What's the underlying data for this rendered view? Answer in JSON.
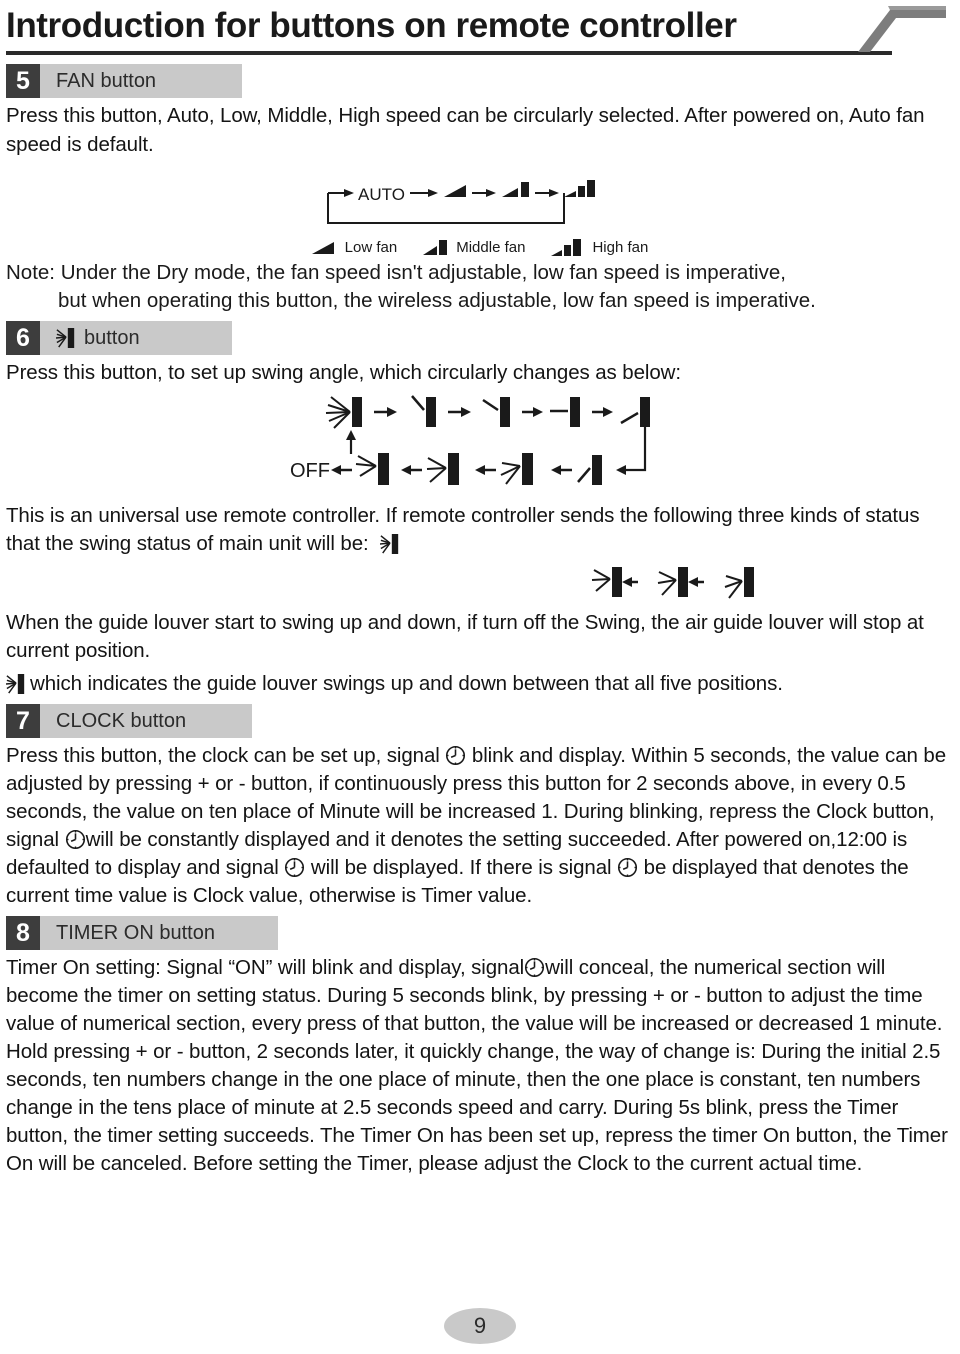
{
  "page": {
    "title": "Introduction for buttons on remote controller",
    "page_number": "9"
  },
  "sections": [
    {
      "number": "5",
      "label": "FAN button",
      "icon": null,
      "paragraphs": [
        "Press this button, Auto, Low, Middle, High speed can be circularly selected. After powered on, Auto fan speed is default."
      ],
      "fan_cycle": {
        "auto_label": "AUTO",
        "steps": [
          "AUTO",
          "low-fan-icon",
          "middle-fan-icon",
          "high-fan-icon"
        ],
        "legend": [
          {
            "icon": "low-fan-icon",
            "label": "Low fan"
          },
          {
            "icon": "middle-fan-icon",
            "label": "Middle fan"
          },
          {
            "icon": "high-fan-icon",
            "label": "High fan"
          }
        ]
      },
      "note": {
        "line1": "Note: Under the Dry mode, the fan speed isn't adjustable, low fan speed is imperative,",
        "line2": "but when operating this button, the wireless adjustable, low fan speed is imperative."
      }
    },
    {
      "number": "6",
      "label": "button",
      "icon": "swing-icon",
      "intro": "Press this button, to set up swing angle, which circularly changes as below:",
      "swing_cycle": {
        "off_label": "OFF",
        "top_row": [
          "swing-all-icon",
          "louver-pos-1-icon",
          "louver-pos-2-icon",
          "louver-pos-3-icon",
          "louver-pos-4-icon"
        ],
        "bottom_row": [
          "louver-pos-5-icon",
          "swing-lower-icon",
          "swing-middle-icon",
          "swing-upper-icon"
        ]
      },
      "paragraphs": [
        "This is an universal use remote controller. If remote controller sends the following three kinds of status that the swing status of main unit will be:",
        "When the guide louver start to swing up and down, if turn off the Swing, the air guide louver will stop at current position.",
        "which indicates the guide louver swings up and down between that all five positions."
      ],
      "status_icons": [
        "swing-status-1-icon",
        "swing-status-2-icon",
        "swing-status-3-icon"
      ]
    },
    {
      "number": "7",
      "label": "CLOCK button",
      "icon": null,
      "text_runs": [
        {
          "t": "Press this button, the clock can be set up, signal "
        },
        {
          "icon": "clock-icon"
        },
        {
          "t": " blink and display. Within 5 seconds, the value can be adjusted by pressing + or - button, if continuously press this button for 2 seconds above, in every 0.5 seconds, the value on ten place of Minute will be increased 1. During blinking, repress the Clock button, signal "
        },
        {
          "icon": "clock-icon"
        },
        {
          "t": "will be constantly displayed and it denotes the setting succeeded. After powered on,12:00 is defaulted to display and signal "
        },
        {
          "icon": "clock-icon"
        },
        {
          "t": " will be displayed. If there is signal "
        },
        {
          "icon": "clock-icon"
        },
        {
          "t": " be displayed that denotes the current time value is Clock value, otherwise is Timer value."
        }
      ]
    },
    {
      "number": "8",
      "label": "TIMER ON button",
      "icon": null,
      "text_runs": [
        {
          "t": "Timer On setting: Signal “ON” will blink and display, signal"
        },
        {
          "icon": "clock-icon"
        },
        {
          "t": "will conceal, the numerical section will become the timer on setting status. During 5 seconds blink, by pressing + or - button to adjust the time value of numerical section, every press of that button, the value will be increased or decreased 1 minute. Hold pressing + or - button, 2 seconds later, it quickly change, the way of change is: During the initial 2.5 seconds, ten numbers change in the one place of minute, then the one place is constant, ten numbers change in the tens place of minute at 2.5 seconds speed and carry. During 5s blink, press the Timer button, the timer setting succeeds. The Timer On has been set up, repress the timer On button, the Timer On will be canceled. Before setting the Timer, please adjust the Clock to the current actual time."
        }
      ]
    }
  ],
  "colors": {
    "number_box": "#3d3d3d",
    "header_bar": "#c9c9c9",
    "text": "#141414",
    "title_rule": "#2a2a2a",
    "flag": "#7d7d7d",
    "page_badge": "#c9c9c9"
  }
}
